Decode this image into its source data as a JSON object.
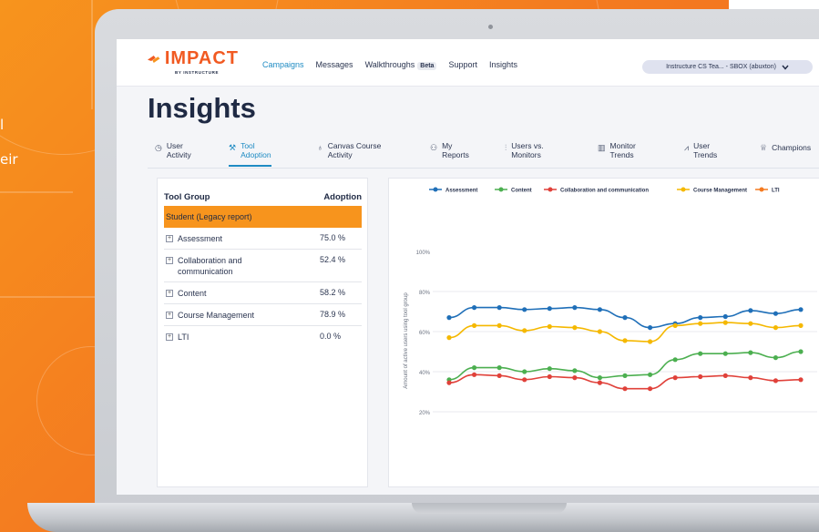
{
  "background_text": {
    "line1": "l",
    "line2": "eir"
  },
  "app": {
    "logo_text": "IMPACT",
    "logo_subtext": "BY INSTRUCTURE",
    "nav": [
      {
        "label": "Campaigns",
        "active": true
      },
      {
        "label": "Messages",
        "active": false
      },
      {
        "label": "Walkthroughs",
        "active": false,
        "badge": "Beta"
      },
      {
        "label": "Support",
        "active": false
      },
      {
        "label": "Insights",
        "active": false
      }
    ],
    "account_label": "Instructure CS Tea... - SBOX (abuxton)",
    "page_title": "Insights"
  },
  "tabs": [
    {
      "icon": "clock-icon",
      "glyph": "◷",
      "label_line1": "User",
      "label_line2": "Activity",
      "active": false
    },
    {
      "icon": "wrench-icon",
      "glyph": "⚒",
      "label_line1": "Tool",
      "label_line2": "Adoption",
      "active": true
    },
    {
      "icon": "graduation-cap-icon",
      "glyph": "♁",
      "label_line1": "Canvas Course",
      "label_line2": "Activity",
      "active": false
    },
    {
      "icon": "person-icon",
      "glyph": "⚇",
      "label_line1": "My",
      "label_line2": "Reports",
      "active": false
    },
    {
      "icon": "bar-chart-icon",
      "glyph": "⫶",
      "label_line1": "Users vs.",
      "label_line2": "Monitors",
      "active": false
    },
    {
      "icon": "monitor-chart-icon",
      "glyph": "▥",
      "label_line1": "Monitor",
      "label_line2": "Trends",
      "active": false
    },
    {
      "icon": "line-chart-icon",
      "glyph": "⩘",
      "label_line1": "User",
      "label_line2": "Trends",
      "active": false
    },
    {
      "icon": "trophy-icon",
      "glyph": "♕",
      "label_line1": "Champions",
      "label_line2": "",
      "active": false
    }
  ],
  "table": {
    "col_group": "Tool Group",
    "col_adoption": "Adoption",
    "group_label": "Student (Legacy report)",
    "rows": [
      {
        "name": "Assessment",
        "value": "75.0 %"
      },
      {
        "name": "Collaboration and communication",
        "value": "52.4 %"
      },
      {
        "name": "Content",
        "value": "58.2 %"
      },
      {
        "name": "Course Management",
        "value": "78.9 %"
      },
      {
        "name": "LTI",
        "value": "0.0 %"
      }
    ]
  },
  "chart_data": {
    "type": "line",
    "title": "",
    "xlabel": "",
    "ylabel": "Amount of active users using tool group",
    "ylim": [
      20,
      100
    ],
    "y_ticks": [
      "100%",
      "80%",
      "60%",
      "40%",
      "20%"
    ],
    "x": [
      1,
      2,
      3,
      4,
      5,
      6,
      7,
      8,
      9,
      10,
      11,
      12,
      13,
      14,
      15
    ],
    "grid": true,
    "legend_position": "top",
    "series": [
      {
        "name": "Assessment",
        "color": "#1f6fb8",
        "values": [
          67,
          72,
          72,
          71,
          71.5,
          72,
          71,
          67,
          62,
          64,
          67,
          67.5,
          70.5,
          69,
          71
        ]
      },
      {
        "name": "Content",
        "color": "#4caf50",
        "values": [
          36,
          42,
          42,
          40,
          41.5,
          40.5,
          37,
          38,
          38.5,
          46,
          49,
          49,
          49.5,
          47,
          50
        ]
      },
      {
        "name": "Collaboration and communication",
        "color": "#e0413a",
        "values": [
          34.5,
          38.5,
          38,
          36,
          37.5,
          37,
          34.5,
          31.5,
          31.5,
          37,
          37.5,
          38,
          37,
          35.5,
          36
        ]
      },
      {
        "name": "Course Management",
        "color": "#f5b800",
        "values": [
          57,
          63,
          63,
          60.5,
          62.5,
          62,
          60,
          55.5,
          55,
          63,
          64,
          64.5,
          64,
          62,
          63
        ]
      },
      {
        "name": "LTI",
        "color": "#f47a20",
        "values": []
      }
    ]
  }
}
